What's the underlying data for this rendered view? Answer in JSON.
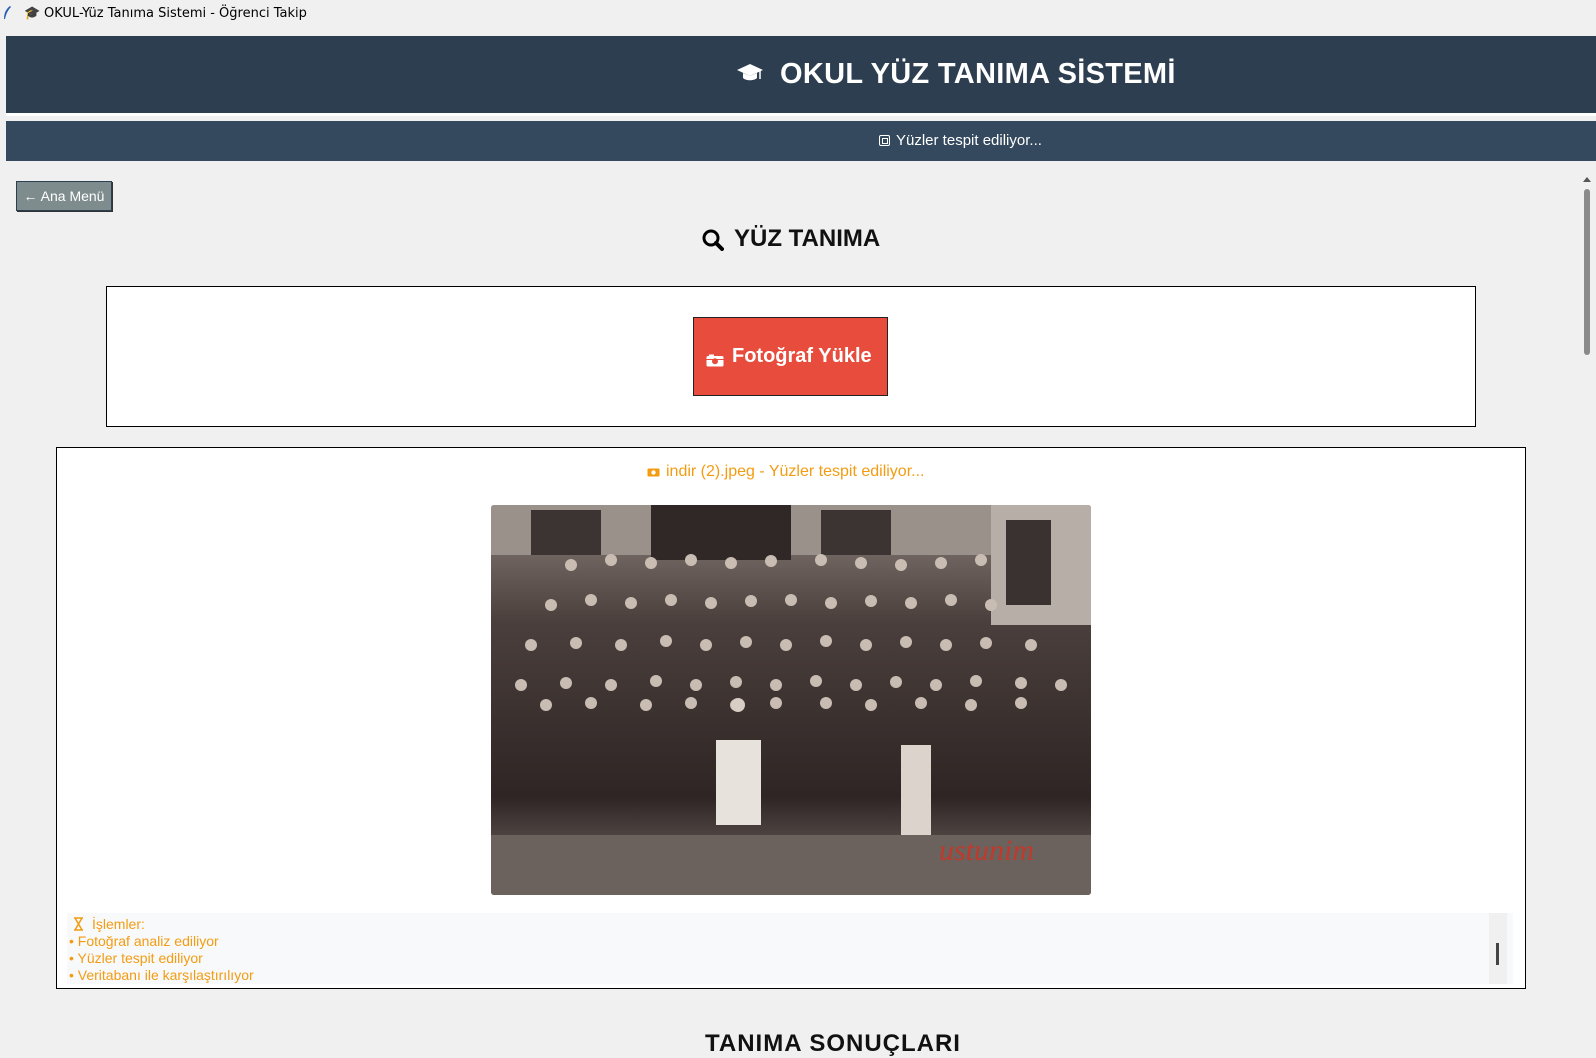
{
  "window": {
    "title": "OKUL-Yüz Tanıma Sistemi - Öğrenci Takip",
    "app_icon": "feather-icon",
    "title_icon": "graduation-cap-icon"
  },
  "header": {
    "title": "OKUL YÜZ TANIMA SİSTEMİ",
    "icon": "graduation-cap-icon",
    "bg_color": "#2c3e50"
  },
  "status_bar": {
    "text": "Yüzler tespit ediliyor...",
    "icon": "scan-icon",
    "bg_color": "#34495e"
  },
  "nav": {
    "back_label": "← Ana Menü"
  },
  "page": {
    "title": "YÜZ TANIMA",
    "title_icon": "magnifier-icon"
  },
  "upload": {
    "button_label": "Fotoğraf Yükle",
    "button_icon": "camera-icon",
    "button_color": "#e74c3c"
  },
  "preview": {
    "status_text": "indir (2).jpeg - Yüzler tespit ediliyor...",
    "status_icon": "camera-icon",
    "status_color": "#f39c12",
    "image_description": "sepia class photograph",
    "watermark": "ustunim"
  },
  "operations": {
    "header": "İşlemler:",
    "header_icon": "hourglass-icon",
    "items": [
      "• Fotoğraf analiz ediliyor",
      "• Yüzler tespit ediliyor",
      "• Veritabanı ile karşılaştırılıyor"
    ]
  },
  "results": {
    "title_partial": "TANIMA SONUÇLARI"
  }
}
